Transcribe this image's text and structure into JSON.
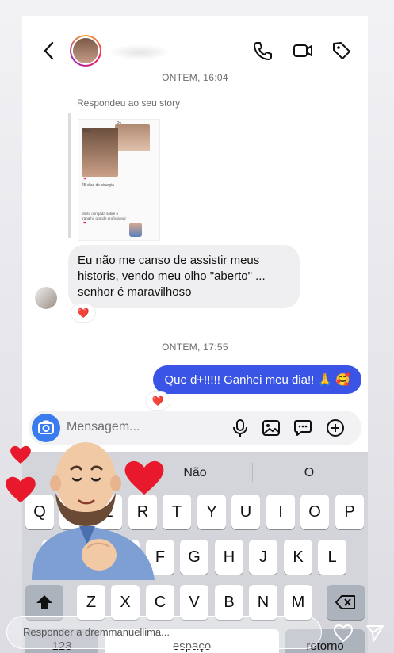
{
  "colors": {
    "accent": "#3a55e6",
    "heart": "#e0245e",
    "camera": "#3a7cf0"
  },
  "header": {
    "back_icon": "chevron-left-icon",
    "icons": [
      "phone-icon",
      "video-icon",
      "tag-icon"
    ]
  },
  "thread": {
    "timestamp_1": "ONTEM, 16:04",
    "reply_note": "Respondeu ao seu story",
    "story_preview": {
      "label_1": "Pos",
      "label_2": "Pv",
      "caption_1": "45 dias de cirurgia",
      "caption_2": "Muito obrigada sobre o trabalho grande profissional"
    },
    "incoming_message": "Eu não me canso de assistir meus historis, vendo meu olho \"aberto\" ... senhor é maravilhoso",
    "incoming_reaction": "❤️",
    "timestamp_2": "ONTEM, 17:55",
    "outgoing_message": "Que d+!!!!! Ganhei meu dia!! 🙏 🥰",
    "outgoing_reaction": "❤️"
  },
  "composer": {
    "placeholder": "Mensagem...",
    "icons": [
      "camera-icon",
      "microphone-icon",
      "gallery-icon",
      "sticker-icon",
      "plus-icon"
    ]
  },
  "keyboard": {
    "suggestions": [
      "",
      "Não",
      "O"
    ],
    "row1": [
      "Q",
      "W",
      "E",
      "R",
      "T",
      "Y",
      "U",
      "I",
      "O",
      "P"
    ],
    "row2": [
      "A",
      "S",
      "D",
      "F",
      "G",
      "H",
      "J",
      "K",
      "L"
    ],
    "row3": [
      "Z",
      "X",
      "C",
      "V",
      "B",
      "N",
      "M"
    ],
    "shift_icon": "shift-icon",
    "backspace_icon": "backspace-icon",
    "numbers_label": "123",
    "space_label": "espaço",
    "return_label": "retorno"
  },
  "story_reply": {
    "placeholder": "Responder a dremmanuellima...",
    "icons": [
      "heart-icon",
      "send-icon"
    ]
  }
}
